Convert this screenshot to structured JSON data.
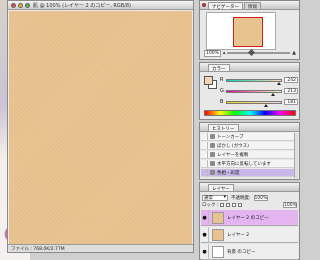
{
  "document": {
    "title": "肌 @ 100% (レイヤー 2 のコピー, RGB/8)",
    "status": "ファイル : 768.0K/2.77M",
    "canvas_color": "#e9c38f"
  },
  "navigator": {
    "tabs": [
      "ナビゲーター",
      "情報"
    ],
    "zoom": "100%"
  },
  "color": {
    "tab": "カラー",
    "foreground": "#f2d5b5",
    "channels": [
      {
        "label": "R",
        "value": "242"
      },
      {
        "label": "G",
        "value": "213"
      },
      {
        "label": "B",
        "value": "181"
      }
    ]
  },
  "history": {
    "tab": "ヒストリー",
    "items": [
      {
        "label": "トーンカーブ"
      },
      {
        "label": "ぼかし (ガウス)"
      },
      {
        "label": "レイヤーを複製"
      },
      {
        "label": "水平方向に反転しています"
      },
      {
        "label": "色相・彩度"
      }
    ]
  },
  "layers": {
    "tab": "レイヤー",
    "blend_mode": "通常",
    "opacity_label": "不透明度:",
    "opacity": "100%",
    "lock_label": "ロック :",
    "fill": "100%",
    "items": [
      {
        "label": "レイヤー 2 のコピー",
        "eye": "●"
      },
      {
        "label": "レイヤー 2",
        "eye": "●"
      },
      {
        "label": "背景 のコピー",
        "eye": "●"
      }
    ]
  }
}
